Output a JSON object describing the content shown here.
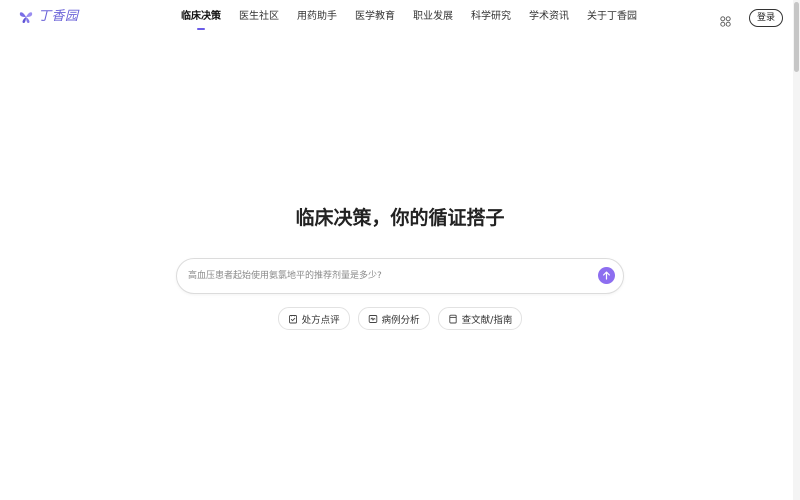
{
  "header": {
    "logo_text": "丁香园",
    "nav": [
      {
        "label": "临床决策",
        "active": true
      },
      {
        "label": "医生社区",
        "active": false
      },
      {
        "label": "用药助手",
        "active": false
      },
      {
        "label": "医学教育",
        "active": false
      },
      {
        "label": "职业发展",
        "active": false
      },
      {
        "label": "科学研究",
        "active": false
      },
      {
        "label": "学术资讯",
        "active": false
      },
      {
        "label": "关于丁香园",
        "active": false
      }
    ],
    "apps_icon": "grid-apps-icon",
    "login_label": "登录"
  },
  "main": {
    "headline": "临床决策，你的循证搭子",
    "search": {
      "placeholder": "高血压患者起始使用氨氯地平的推荐剂量是多少?",
      "value": ""
    },
    "send_icon": "arrow-up-icon",
    "chips": [
      {
        "label": "处方点评",
        "icon": "prescription-icon"
      },
      {
        "label": "病例分析",
        "icon": "case-icon"
      },
      {
        "label": "查文献/指南",
        "icon": "document-icon"
      }
    ]
  },
  "colors": {
    "accent": "#8d6ef0",
    "nav_indicator": "#6b5ce7",
    "logo": "#6b63d8"
  }
}
